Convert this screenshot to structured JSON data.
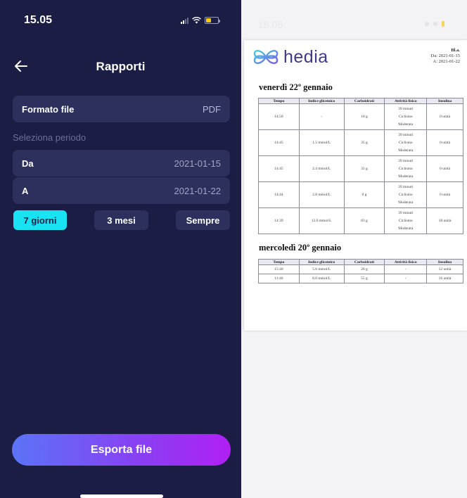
{
  "left": {
    "status": {
      "time": "15.05"
    },
    "header": {
      "title": "Rapporti"
    },
    "format": {
      "label": "Formato file",
      "value": "PDF"
    },
    "period_section_label": "Seleziona periodo",
    "from": {
      "label": "Da",
      "value": "2021-01-15"
    },
    "to": {
      "label": "A",
      "value": "2021-01-22"
    },
    "periods": [
      {
        "label": "7 giorni",
        "selected": true
      },
      {
        "label": "3 mesi",
        "selected": false
      },
      {
        "label": "Sempre",
        "selected": false
      }
    ],
    "export_label": "Esporta file"
  },
  "right": {
    "status": {
      "time": "15.05"
    },
    "pdf": {
      "brand": "hedia",
      "meta": {
        "name": "Bl.a.",
        "from": "Da: 2021-01-15",
        "to": "A: 2021-01-22"
      },
      "columns": [
        "Tempo",
        "Indice glicemico",
        "Carboidrati",
        "Attività fisica",
        "Insulina"
      ],
      "days": [
        {
          "title": "venerdì 22º gennaio",
          "rows": [
            [
              "14:50",
              "-",
              "10 g",
              "39 minuti",
              "Ciclismo",
              "Moderata",
              "0 unità"
            ],
            [
              "14:45",
              "1.5 mmol/L",
              "35 g",
              "39 minuti",
              "Ciclismo",
              "Moderata",
              "0 unità"
            ],
            [
              "14:45",
              "2.4 mmol/L",
              "33 g",
              "39 minuti",
              "Ciclismo",
              "Moderata",
              "0 unità"
            ],
            [
              "14:44",
              "2.8 mmol/L",
              "0 g",
              "39 minuti",
              "Ciclismo",
              "Moderata",
              "0 unità"
            ],
            [
              "14:39",
              "12.0 mmol/L",
              "83 g",
              "39 minuti",
              "Ciclismo",
              "Moderata",
              "18 unità"
            ]
          ]
        },
        {
          "title": "mercoledì 20º gennaio",
          "rows": [
            [
              "15:40",
              "5.6 mmol/L",
              "20 g",
              "-",
              "12 unità"
            ],
            [
              "11:40",
              "8.0 mmol/L",
              "55 g",
              "-",
              "16 unità"
            ]
          ]
        }
      ]
    }
  },
  "colors": {
    "background": "#1c1d44",
    "row": "#2d2f5c",
    "accent": "#19e3f2",
    "gradient_start": "#5b74f7",
    "gradient_end": "#b11ff4",
    "brand": "#3e3a8a"
  }
}
